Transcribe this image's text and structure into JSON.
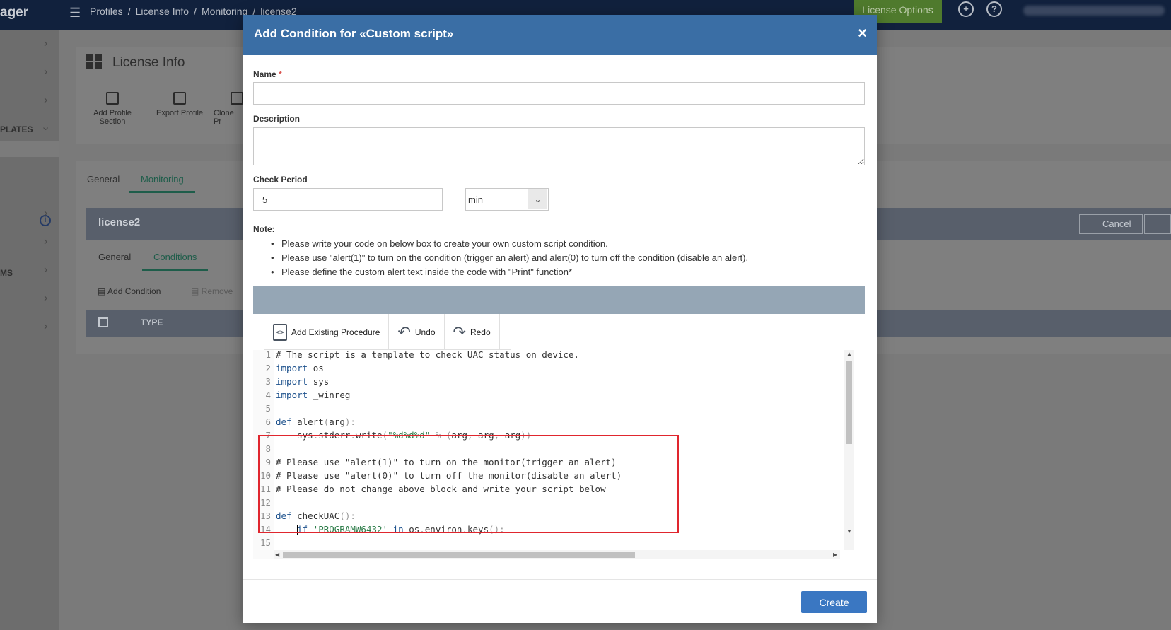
{
  "app": {
    "title_fragment": "ager",
    "breadcrumb": [
      "Profiles",
      "License Info",
      "Monitoring",
      "license2"
    ],
    "license_options": "License Options",
    "sidebar_labels": [
      "PLATES",
      "MS"
    ]
  },
  "background": {
    "page_title": "License Info",
    "tools": [
      "Add Profile Section",
      "Export Profile",
      "Clone Pr"
    ],
    "tabs": [
      "General",
      "Monitoring"
    ],
    "item_title": "license2",
    "cancel_label": "Cancel",
    "sub_tabs": [
      "General",
      "Conditions"
    ],
    "add_condition": "Add Condition",
    "remove": "Remove",
    "column_type": "TYPE"
  },
  "modal": {
    "title": "Add Condition for «Custom script»",
    "close_symbol": "×",
    "name_label": "Name",
    "required_mark": "*",
    "name_value": "",
    "description_label": "Description",
    "description_value": "",
    "check_period_label": "Check Period",
    "check_period_value": "5",
    "period_unit": "min",
    "note_label": "Note:",
    "notes": [
      "Please write your code on below box to create your own custom script condition.",
      "Please use \"alert(1)\" to turn on the condition (trigger an alert) and alert(0) to turn off the condition (disable an alert).",
      "Please define the custom alert text inside the code with \"Print\" function*"
    ],
    "toolbar": {
      "add_existing": "Add Existing Procedure",
      "undo": "Undo",
      "redo": "Redo"
    },
    "code_lines": [
      "# The script is a template to check UAC status on device.",
      "import os",
      "import sys",
      "import _winreg",
      "",
      "def alert(arg):",
      "    sys.stderr.write(\"%d%d%d\" % (arg, arg, arg))",
      "",
      "# Please use \"alert(1)\" to turn on the monitor(trigger an alert)",
      "# Please use \"alert(0)\" to turn off the monitor(disable an alert)",
      "# Please do not change above block and write your script below",
      "",
      "def checkUAC():",
      "    if 'PROGRAMW6432' in os.environ.keys():",
      ""
    ],
    "create_label": "Create"
  },
  "colors": {
    "modal_header": "#3a6ea5",
    "primary_button": "#3a77c2",
    "highlight_border": "#e0262e",
    "keyword": "#1a4f8b",
    "string": "#2e7d4a"
  }
}
